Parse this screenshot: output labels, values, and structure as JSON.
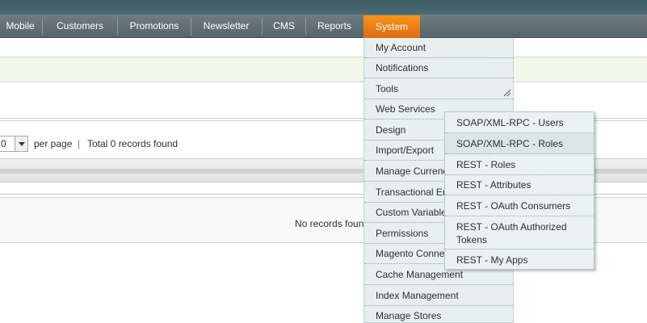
{
  "nav": {
    "items": [
      {
        "label": "Mobile"
      },
      {
        "label": "Customers"
      },
      {
        "label": "Promotions"
      },
      {
        "label": "Newsletter"
      },
      {
        "label": "CMS"
      },
      {
        "label": "Reports"
      },
      {
        "label": "System"
      }
    ],
    "active": "System"
  },
  "pager": {
    "per_page_value": "0",
    "per_page_label": "per page",
    "separator": "|",
    "records_text": "Total 0 records found"
  },
  "grid": {
    "empty_text": "No records found."
  },
  "system_menu": {
    "items": [
      {
        "label": "My Account"
      },
      {
        "label": "Notifications"
      },
      {
        "label": "Tools"
      },
      {
        "label": "Web Services"
      },
      {
        "label": "Design"
      },
      {
        "label": "Import/Export"
      },
      {
        "label": "Manage Currency"
      },
      {
        "label": "Transactional Emails"
      },
      {
        "label": "Custom Variables"
      },
      {
        "label": "Permissions"
      },
      {
        "label": "Magento Connect"
      },
      {
        "label": "Cache Management"
      },
      {
        "label": "Index Management"
      },
      {
        "label": "Manage Stores"
      }
    ]
  },
  "web_services_submenu": {
    "items": [
      {
        "label": "SOAP/XML-RPC - Users"
      },
      {
        "label": "SOAP/XML-RPC - Roles"
      },
      {
        "label": "REST - Roles"
      },
      {
        "label": "REST - Attributes"
      },
      {
        "label": "REST - OAuth Consumers"
      },
      {
        "label": "REST - OAuth Authorized Tokens"
      },
      {
        "label": "REST - My Apps"
      }
    ],
    "hovered": "SOAP/XML-RPC - Roles"
  },
  "colors": {
    "nav_bg": "#5f6e73",
    "active_tab": "#eb7d16",
    "menu_bg": "#e7eff1",
    "notice_bg": "#f1f7ea"
  }
}
